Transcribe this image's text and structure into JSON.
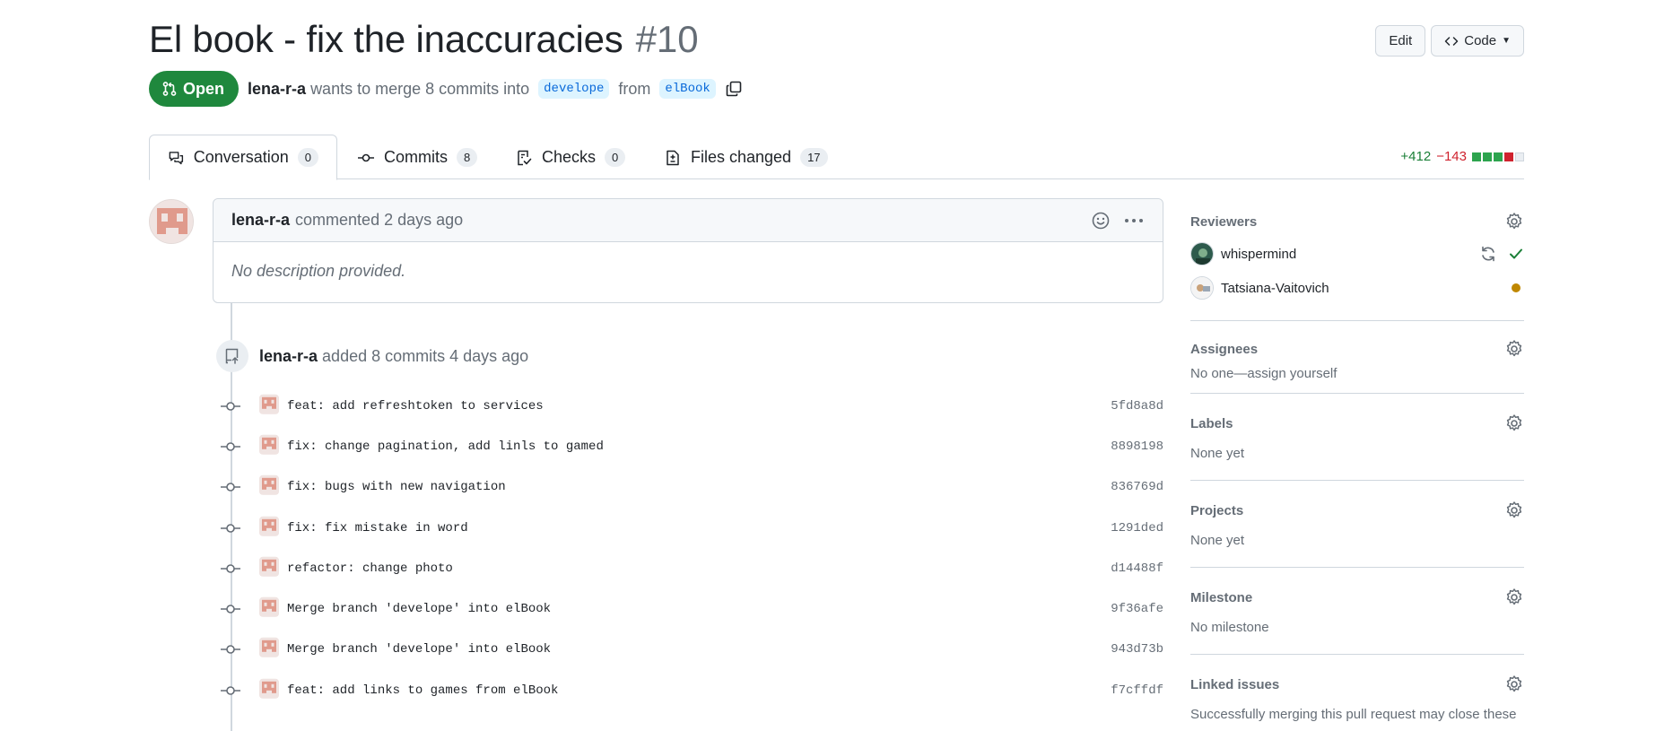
{
  "header": {
    "title": "El book - fix the inaccuracies",
    "number": "#10",
    "edit_label": "Edit",
    "code_label": "Code"
  },
  "meta": {
    "state": "Open",
    "author": "lena-r-a",
    "text_merge": "wants to merge 8 commits into",
    "base_branch": "develope",
    "text_from": "from",
    "head_branch": "elBook"
  },
  "tabs": [
    {
      "label": "Conversation",
      "count": "0",
      "icon": "comment-discussion-icon"
    },
    {
      "label": "Commits",
      "count": "8",
      "icon": "git-commit-icon"
    },
    {
      "label": "Checks",
      "count": "0",
      "icon": "checklist-icon"
    },
    {
      "label": "Files changed",
      "count": "17",
      "icon": "file-diff-icon"
    }
  ],
  "diffstat": {
    "additions": "+412",
    "deletions": "−143",
    "blocks": [
      "#2da44e",
      "#2da44e",
      "#2da44e",
      "#cf222e",
      "#eaeef2"
    ]
  },
  "comment": {
    "author": "lena-r-a",
    "action": "commented 2 days ago",
    "body": "No description provided."
  },
  "commit_event": {
    "author": "lena-r-a",
    "action": "added 8 commits 4 days ago"
  },
  "commits": [
    {
      "message": "feat: add refreshtoken to services",
      "sha": "5fd8a8d"
    },
    {
      "message": "fix: change pagination, add linls to gamed",
      "sha": "8898198"
    },
    {
      "message": "fix: bugs with new navigation",
      "sha": "836769d"
    },
    {
      "message": "fix: fix mistake in word",
      "sha": "1291ded"
    },
    {
      "message": "refactor: change photo",
      "sha": "d14488f"
    },
    {
      "message": "Merge branch 'develope' into elBook",
      "sha": "9f36afe"
    },
    {
      "message": "Merge branch 'develope' into elBook",
      "sha": "943d73b"
    },
    {
      "message": "feat: add links to games from elBook",
      "sha": "f7cffdf"
    }
  ],
  "sidebar": {
    "reviewers": {
      "title": "Reviewers",
      "items": [
        {
          "name": "whispermind",
          "status": "approved"
        },
        {
          "name": "Tatsiana-Vaitovich",
          "status": "pending"
        }
      ]
    },
    "assignees": {
      "title": "Assignees",
      "value": "No one—assign yourself"
    },
    "labels": {
      "title": "Labels",
      "value": "None yet"
    },
    "projects": {
      "title": "Projects",
      "value": "None yet"
    },
    "milestone": {
      "title": "Milestone",
      "value": "No milestone"
    },
    "linked_issues": {
      "title": "Linked issues",
      "value": "Successfully merging this pull request may close these"
    }
  },
  "colors": {
    "open_green": "#1f883d",
    "link_blue": "#0969da",
    "muted": "#656d76",
    "approved_green": "#1a7f37",
    "pending_yellow": "#bf8700"
  }
}
